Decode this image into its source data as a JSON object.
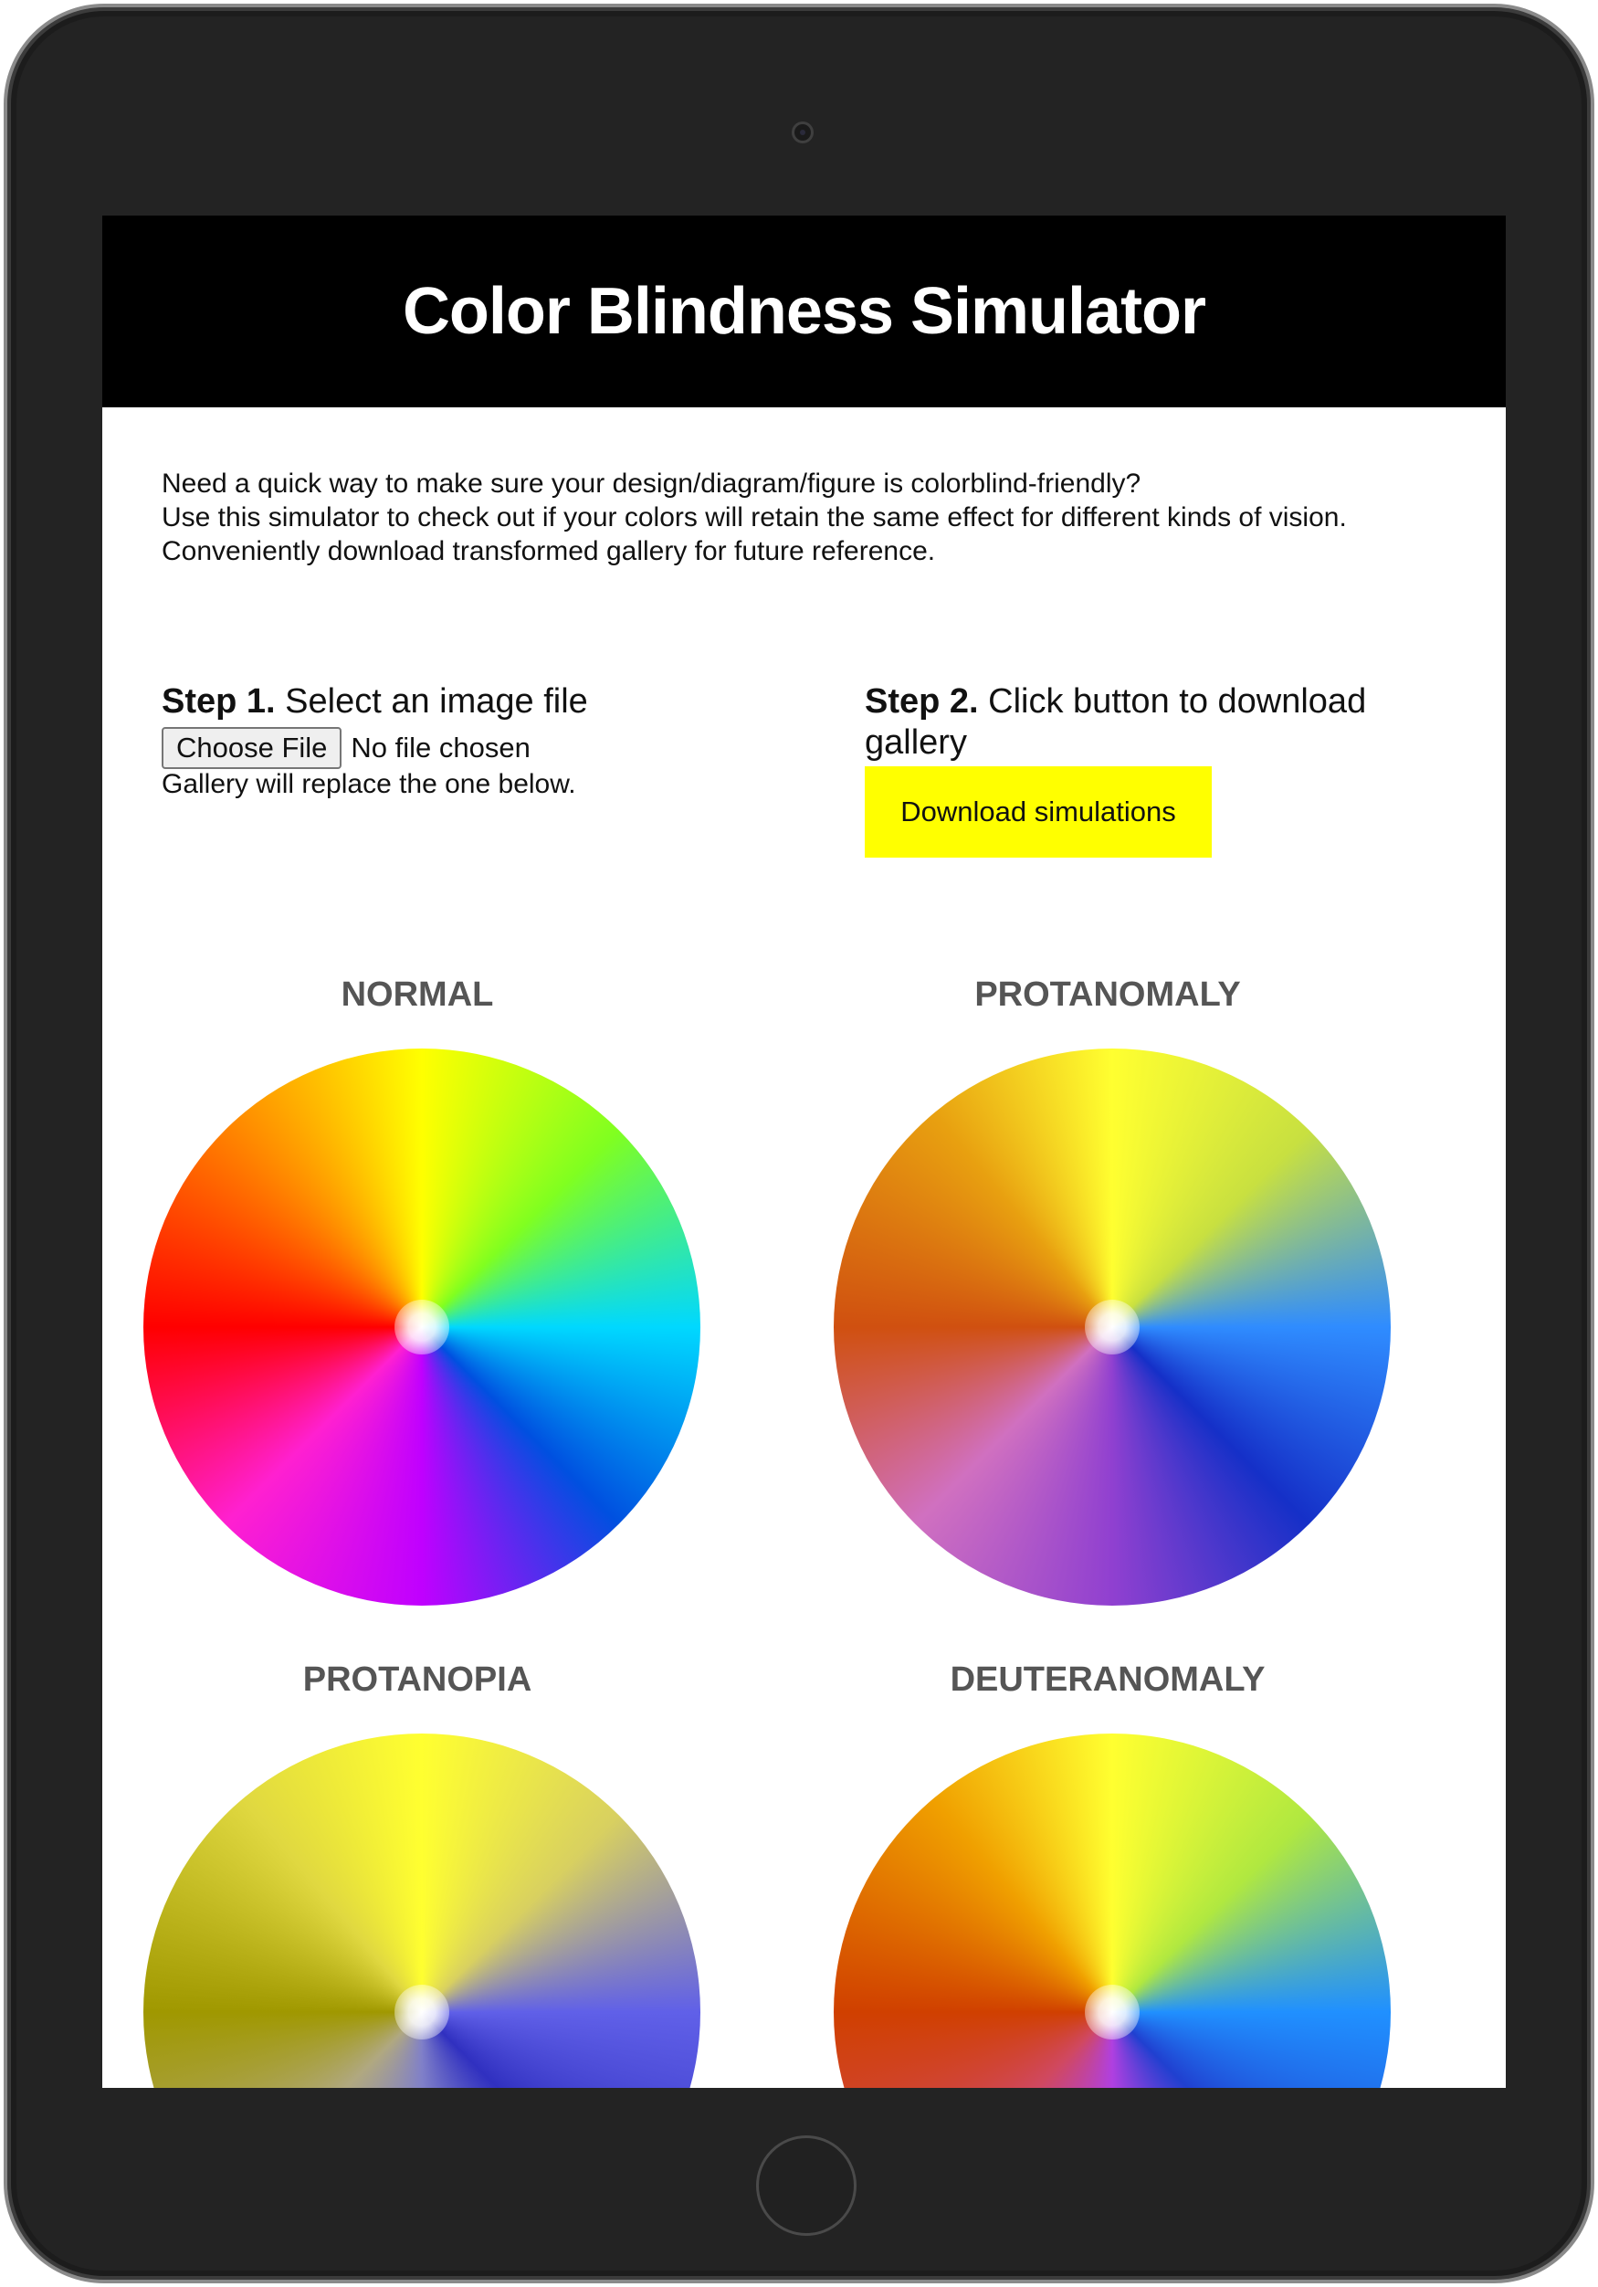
{
  "app": {
    "title": "Color Blindness Simulator"
  },
  "intro": {
    "lines": [
      "Need a quick way to make sure your design/diagram/figure is colorblind-friendly?",
      "Use this simulator to check out if your colors will retain the same effect for different kinds of vision.",
      "Conveniently download transformed gallery for future reference."
    ]
  },
  "step1": {
    "label": "Step 1.",
    "text": " Select an image file",
    "button_label": "Choose File",
    "file_status": "No file chosen",
    "note": "Gallery will replace the one below."
  },
  "step2": {
    "label": "Step 2.",
    "text": " Click button to download gallery",
    "button_label": "Download simulations",
    "button_color": "#ffff00"
  },
  "gallery": {
    "items": [
      {
        "label": "NORMAL"
      },
      {
        "label": "PROTANOMALY"
      },
      {
        "label": "PROTANOPIA"
      },
      {
        "label": "DEUTERANOMALY"
      }
    ]
  },
  "colors": {
    "header_bg": "#000000",
    "header_text": "#ffffff",
    "label_text": "#555555",
    "device_body": "#232323"
  },
  "icons": {
    "camera": "camera-icon",
    "home": "home-button-icon"
  }
}
